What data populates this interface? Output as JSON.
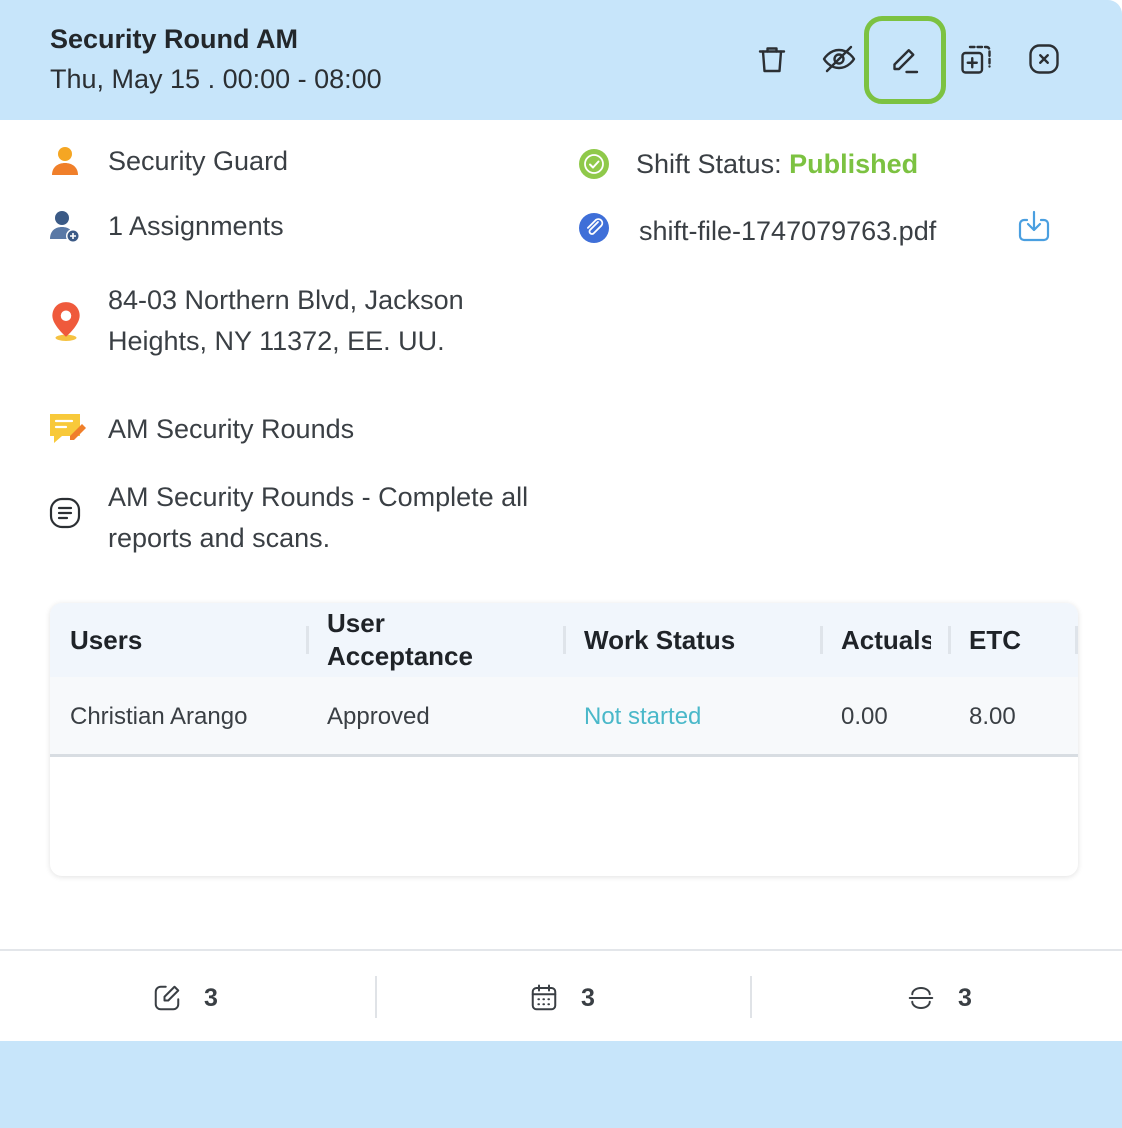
{
  "header": {
    "title": "Security Round AM",
    "subtitle": "Thu, May 15 . 00:00 - 08:00",
    "actions": [
      "trash-icon",
      "eye-off-icon",
      "edit-icon",
      "duplicate-icon",
      "close-icon"
    ]
  },
  "details": {
    "position": "Security Guard",
    "assignments": "1 Assignments",
    "address_line1": "84-03 Northern Blvd, Jackson",
    "address_line2": "Heights, NY 11372, EE. UU.",
    "note_title": "AM Security Rounds",
    "description_line1": "AM Security Rounds - Complete all",
    "description_line2": "reports and scans.",
    "status_label": "Shift Status:",
    "status_value": "Published",
    "attachment": "shift-file-1747079763.pdf"
  },
  "table": {
    "headers": {
      "users": "Users",
      "acceptance_line1": "User",
      "acceptance_line2": "Acceptance",
      "work_status": "Work Status",
      "actuals": "Actuals",
      "etc": "ETC"
    },
    "rows": [
      {
        "user": "Christian Arango",
        "acceptance": "Approved",
        "work_status": "Not started",
        "actuals": "0.00",
        "etc": "8.00"
      }
    ]
  },
  "footer": {
    "edits": "3",
    "calendar": "3",
    "strike": "3"
  },
  "colors": {
    "header_bg": "#c7e5fa",
    "published": "#7cc241",
    "not_started": "#4ab8c9",
    "download": "#4a9fe0",
    "highlight": "#7cc241"
  }
}
